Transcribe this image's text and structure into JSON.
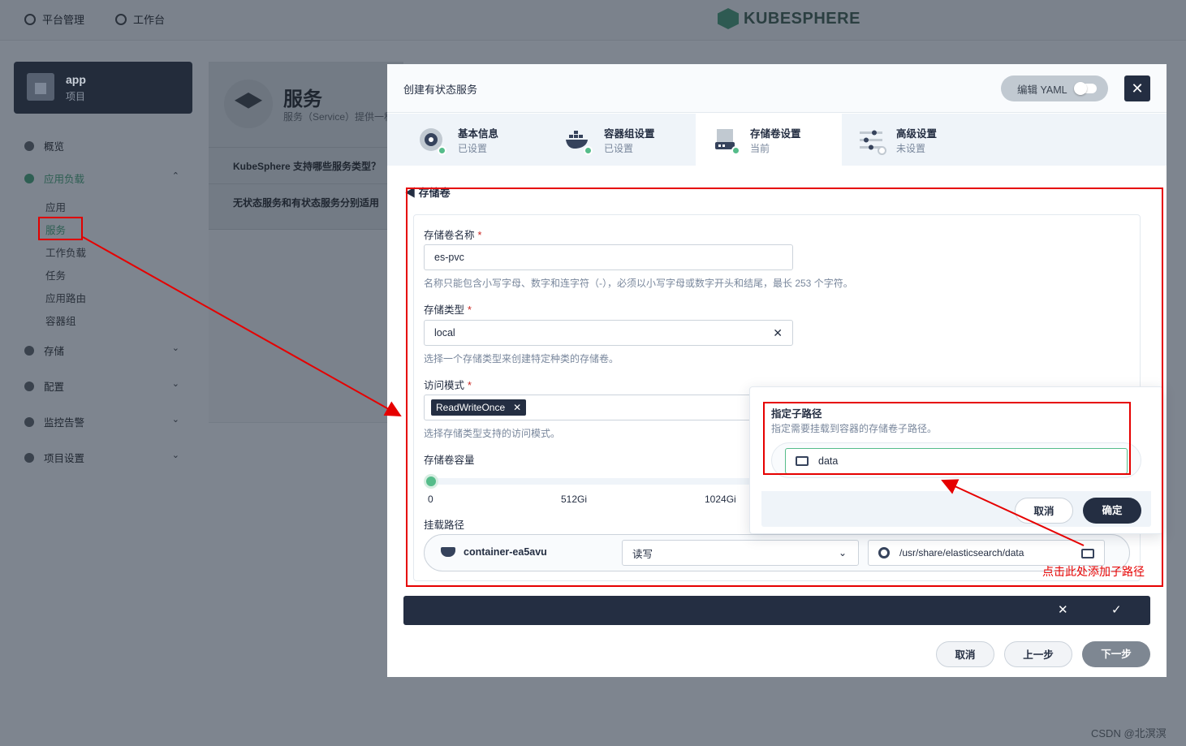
{
  "topbar": {
    "platform_label": "平台管理",
    "workbench_label": "工作台",
    "brand": "KUBESPHERE"
  },
  "project": {
    "name": "app",
    "type": "项目"
  },
  "sidebar": {
    "overview": "概览",
    "workloads": "应用负载",
    "sub_items": [
      "应用",
      "服务",
      "工作负载",
      "任务",
      "应用路由",
      "容器组"
    ],
    "storage": "存储",
    "config": "配置",
    "monitoring": "监控告警",
    "project_settings": "项目设置"
  },
  "background_page": {
    "title": "服务",
    "desc": "服务（Service）提供一种",
    "faq1": "KubeSphere 支持哪些服务类型？",
    "faq2": "无状态服务和有状态服务分别适用"
  },
  "modal": {
    "title": "创建有状态服务",
    "yaml_label": "编辑 YAML",
    "close_icon": "close-icon",
    "steps": [
      {
        "name": "基本信息",
        "state": "已设置",
        "icon": "info-icon"
      },
      {
        "name": "容器组设置",
        "state": "已设置",
        "icon": "docker-icon"
      },
      {
        "name": "存储卷设置",
        "state": "当前",
        "icon": "storage-icon"
      },
      {
        "name": "高级设置",
        "state": "未设置",
        "icon": "sliders-icon"
      }
    ],
    "section_title": "存储卷",
    "form": {
      "name_label": "存储卷名称",
      "name_value": "es-pvc",
      "name_hint": "名称只能包含小写字母、数字和连字符（-），必须以小写字母或数字开头和结尾，最长 253 个字符。",
      "class_label": "存储类型",
      "class_value": "local",
      "class_hint": "选择一个存储类型来创建特定种类的存储卷。",
      "access_label": "访问模式",
      "access_value": "ReadWriteOnce",
      "access_hint": "选择存储类型支持的访问模式。",
      "capacity_label": "存储卷容量",
      "capacity_value_gi": 0,
      "capacity_ticks": [
        "0",
        "512Gi",
        "1024Gi"
      ],
      "mount_label": "挂载路径",
      "container": "container-ea5avu",
      "mount_mode": "读写",
      "mount_path": "/usr/share/elasticsearch/data"
    },
    "footer": {
      "cancel": "取消",
      "prev": "上一步",
      "next": "下一步"
    }
  },
  "popover": {
    "title": "指定子路径",
    "desc": "指定需要挂载到容器的存储卷子路径。",
    "value": "data",
    "cancel": "取消",
    "confirm": "确定"
  },
  "annotation": {
    "text": "点击此处添加子路径",
    "color": "#e60000"
  },
  "watermark": "CSDN @北溟溟",
  "colors": {
    "primary_dark": "#242e42",
    "success": "#55bc8a",
    "annotation_red": "#e60000"
  }
}
